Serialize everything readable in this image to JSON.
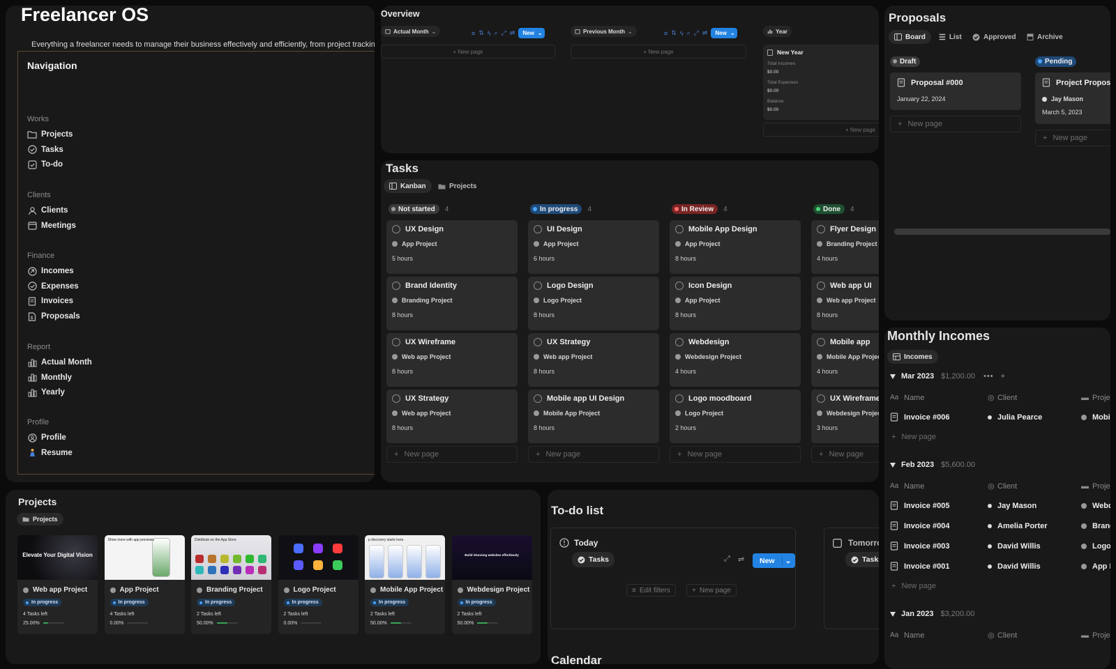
{
  "app": {
    "title": "Freelancer OS",
    "description": "Everything a freelancer needs to manage their business effectively and efficiently, from project tracking"
  },
  "navigation": {
    "title": "Navigation",
    "groups": [
      {
        "label": "Works",
        "items": [
          {
            "label": "Projects",
            "icon": "folder-icon"
          },
          {
            "label": "Tasks",
            "icon": "check-circle-icon"
          },
          {
            "label": "To-do",
            "icon": "checkbox-icon"
          }
        ]
      },
      {
        "label": "Clients",
        "items": [
          {
            "label": "Clients",
            "icon": "person-icon"
          },
          {
            "label": "Meetings",
            "icon": "calendar-icon"
          }
        ]
      },
      {
        "label": "Finance",
        "items": [
          {
            "label": "Incomes",
            "icon": "income-icon"
          },
          {
            "label": "Expenses",
            "icon": "expense-icon"
          },
          {
            "label": "Invoices",
            "icon": "document-icon"
          },
          {
            "label": "Proposals",
            "icon": "document-dollar-icon"
          }
        ]
      },
      {
        "label": "Report",
        "items": [
          {
            "label": "Actual Month",
            "icon": "bar-chart-icon"
          },
          {
            "label": "Monthly",
            "icon": "bar-chart-icon"
          },
          {
            "label": "Yearly",
            "icon": "bar-chart-icon"
          }
        ]
      },
      {
        "label": "Profile",
        "items": [
          {
            "label": "Profile",
            "icon": "profile-circle-icon"
          },
          {
            "label": "Resume",
            "icon": "person-standing-icon"
          }
        ]
      }
    ]
  },
  "overview": {
    "title": "Overview",
    "views": [
      {
        "label": "Actual Month",
        "new_label": "New",
        "new_page": "New page"
      },
      {
        "label": "Previous Month",
        "new_label": "New",
        "new_page": "New page"
      },
      {
        "label": "Year",
        "new_page": "New page"
      }
    ],
    "year_card": {
      "title": "New Year",
      "rows": [
        {
          "label": "Total Incomes",
          "value": "$0.00"
        },
        {
          "label": "Total Expenses",
          "value": "$0.00"
        },
        {
          "label": "Balance",
          "value": "$0.00"
        }
      ]
    }
  },
  "tasks": {
    "title": "Tasks",
    "tabs": [
      "Kanban",
      "Projects"
    ],
    "new_page": "New page",
    "columns": [
      {
        "status": "Not started",
        "count": "4",
        "color": "#3a3a3a",
        "dot": "#9b9b9b",
        "cards": [
          {
            "name": "UX Design",
            "project": "App Project",
            "hours": "5 hours"
          },
          {
            "name": "Brand Identity",
            "project": "Branding Project",
            "hours": "8 hours"
          },
          {
            "name": "UX Wireframe",
            "project": "Web app Project",
            "hours": "8 hours"
          },
          {
            "name": "UX Strategy",
            "project": "Web app Project",
            "hours": "8 hours"
          }
        ]
      },
      {
        "status": "In progress",
        "count": "4",
        "color": "#1f4a78",
        "dot": "#4aa3ff",
        "cards": [
          {
            "name": "UI Design",
            "project": "App Project",
            "hours": "6 hours"
          },
          {
            "name": "Logo Design",
            "project": "Logo Project",
            "hours": "8 hours"
          },
          {
            "name": "UX Strategy",
            "project": "Web app Project",
            "hours": "8 hours"
          },
          {
            "name": "Mobile app UI Design",
            "project": "Mobile App Project",
            "hours": "8 hours"
          }
        ]
      },
      {
        "status": "In Review",
        "count": "4",
        "color": "#7a2424",
        "dot": "#ff6b6b",
        "cards": [
          {
            "name": "Mobile App Design",
            "project": "App Project",
            "hours": "8 hours"
          },
          {
            "name": "Icon Design",
            "project": "App Project",
            "hours": "8 hours"
          },
          {
            "name": "Webdesign",
            "project": "Webdesign Project",
            "hours": "4 hours"
          },
          {
            "name": "Logo moodboard",
            "project": "Logo Project",
            "hours": "2 hours"
          }
        ]
      },
      {
        "status": "Done",
        "count": "4",
        "color": "#1e5030",
        "dot": "#4cd07a",
        "cards": [
          {
            "name": "Flyer Design",
            "project": "Branding Project",
            "hours": "4 hours"
          },
          {
            "name": "Web app UI",
            "project": "Web app Project",
            "hours": "8 hours"
          },
          {
            "name": "Mobile app",
            "project": "Mobile App Project",
            "hours": "4 hours"
          },
          {
            "name": "UX Wireframe",
            "project": "Webdesign Project",
            "hours": "3 hours"
          }
        ]
      }
    ]
  },
  "proposals": {
    "title": "Proposals",
    "tabs": [
      "Board",
      "List",
      "Approved",
      "Archive"
    ],
    "new_page": "New page",
    "columns": [
      {
        "status": "Draft",
        "color": "#3a3a3a",
        "dot": "#9b9b9b",
        "card": {
          "name": "Proposal #000",
          "client": "",
          "date": "January 22, 2024"
        }
      },
      {
        "status": "Pending",
        "color": "#1f4a78",
        "dot": "#4aa3ff",
        "card": {
          "name": "Project Proposal",
          "client": "Jay Mason",
          "date": "March 5, 2023"
        }
      }
    ]
  },
  "incomes": {
    "title": "Monthly Incomes",
    "tab": "Incomes",
    "headers": {
      "name": "Name",
      "client": "Client",
      "project": "Project"
    },
    "new_page": "New page",
    "groups": [
      {
        "month": "Mar 2023",
        "total": "$1,200.00",
        "rows": [
          {
            "invoice": "Invoice #006",
            "client": "Julia Pearce",
            "project": "Mobile App Project"
          }
        ]
      },
      {
        "month": "Feb 2023",
        "total": "$5,600.00",
        "rows": [
          {
            "invoice": "Invoice #005",
            "client": "Jay Mason",
            "project": "Webdesign Project"
          },
          {
            "invoice": "Invoice #004",
            "client": "Amelia Porter",
            "project": "Branding Project"
          },
          {
            "invoice": "Invoice #003",
            "client": "David Willis",
            "project": "Logo Project"
          },
          {
            "invoice": "Invoice #001",
            "client": "David Willis",
            "project": "App Project"
          }
        ]
      },
      {
        "month": "Jan 2023",
        "total": "$3,200.00",
        "rows": []
      }
    ]
  },
  "projects": {
    "title": "Projects",
    "tab": "Projects",
    "cards": [
      {
        "name": "Web app Project",
        "status": "In progress",
        "tasks_left": "4 Tasks left",
        "progress": "25.00%",
        "progress_value": 0.25,
        "thumb_text": "Elevate Your Digital Vision"
      },
      {
        "name": "App Project",
        "status": "In progress",
        "tasks_left": "4 Tasks left",
        "progress": "0.00%",
        "progress_value": 0.0,
        "thumb_text": "Show more with app previews"
      },
      {
        "name": "Branding Project",
        "status": "In progress",
        "tasks_left": "2 Tasks left",
        "progress": "50.00%",
        "progress_value": 0.5,
        "thumb_text": "Distribute on the App Store"
      },
      {
        "name": "Logo Project",
        "status": "In progress",
        "tasks_left": "2 Tasks left",
        "progress": "0.00%",
        "progress_value": 0.0,
        "thumb_text": ""
      },
      {
        "name": "Mobile App Project",
        "status": "In progress",
        "tasks_left": "2 Tasks left",
        "progress": "50.00%",
        "progress_value": 0.5,
        "thumb_text": "p discovery starts here."
      },
      {
        "name": "Webdesign Project",
        "status": "In progress",
        "tasks_left": "2 Tasks left",
        "progress": "50.00%",
        "progress_value": 0.5,
        "thumb_text": "Build Stunning websites effortlessly"
      }
    ]
  },
  "todo": {
    "title": "To-do list",
    "today": {
      "title": "Today",
      "tab": "Tasks",
      "new_label": "New",
      "edit_filters": "Edit filters",
      "new_page": "New page"
    },
    "tomorrow": {
      "title": "Tomorrow",
      "tab": "Tasks"
    },
    "calendar_title": "Calendar"
  },
  "colors": {
    "accent": "#2383e2",
    "panel": "#191919",
    "card": "#2c2c2c"
  }
}
